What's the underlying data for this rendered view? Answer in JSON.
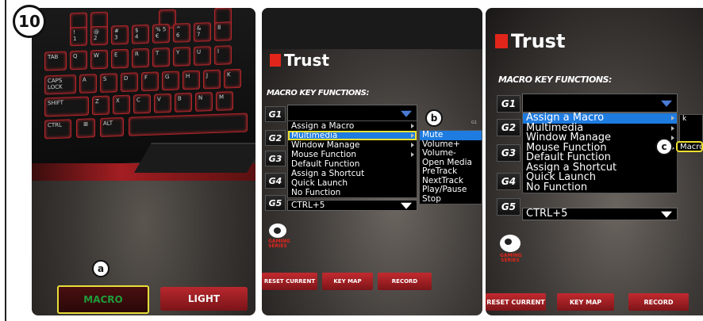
{
  "step": {
    "number": "10"
  },
  "panel1": {
    "keyboard_rows": [
      [
        "!",
        "1",
        "@",
        "2",
        "#",
        "3",
        "$",
        "4",
        "% 5 €",
        "^",
        "6",
        "&",
        "7",
        "8"
      ],
      [
        "TAB",
        "Q",
        "W",
        "E",
        "R",
        "T",
        "Y",
        "U",
        "I"
      ],
      [
        "CAPS LOCK",
        "A",
        "S",
        "D",
        "F",
        "G",
        "H",
        "J",
        "K"
      ],
      [
        "SHIFT",
        "Z",
        "X",
        "C",
        "V",
        "B",
        "N",
        "M"
      ],
      [
        "CTRL",
        "⊞",
        "ALT"
      ]
    ],
    "callout_a": "a",
    "macro_button": "MACRO",
    "light_button": "LIGHT"
  },
  "panel2": {
    "logo": "Trust",
    "section_title": "MACRO KEY FUNCTIONS:",
    "g_keys": [
      "G1",
      "G2",
      "G3",
      "G4",
      "G5"
    ],
    "g5_value": "CTRL+5",
    "menu_items": [
      "Assign a Macro",
      "Multimedia",
      "Window Manage",
      "Mouse Function",
      "Default Function",
      "Assign a Shortcut",
      "Quick Launch",
      "No Function"
    ],
    "submenu_items": [
      "Mute",
      "Volume+",
      "Volume-",
      "Open Media",
      "PreTrack",
      "NextTrack",
      "Play/Pause",
      "Stop"
    ],
    "callout_b": "b",
    "g1_extra": "G1",
    "gaming_series": "GAMING SERIES",
    "buttons": {
      "reset": "RESET CURRENT",
      "keymap": "KEY MAP",
      "record": "RECORD"
    }
  },
  "panel3": {
    "logo": "Trust",
    "section_title": "MACRO KEY FUNCTIONS:",
    "g_keys": [
      "G1",
      "G2",
      "G3",
      "G4",
      "G5"
    ],
    "g5_value": "CTRL+5",
    "menu_items": [
      "Assign a Macro",
      "Multimedia",
      "Window Manage",
      "Mouse Function",
      "Default Function",
      "Assign a Shortcut",
      "Quick Launch",
      "No Function"
    ],
    "submenu_first": "k",
    "callout_c": "c",
    "macro_tooltip": "Macro",
    "gaming_series": "GAMING SERIES",
    "buttons": {
      "reset": "RESET CURRENT",
      "keymap": "KEY MAP",
      "record": "RECORD"
    }
  },
  "colors": {
    "accent_red": "#e1251b",
    "selection_blue": "#1e7be0",
    "highlight_yellow": "#f0e030",
    "macro_green": "#1e9c3a"
  }
}
